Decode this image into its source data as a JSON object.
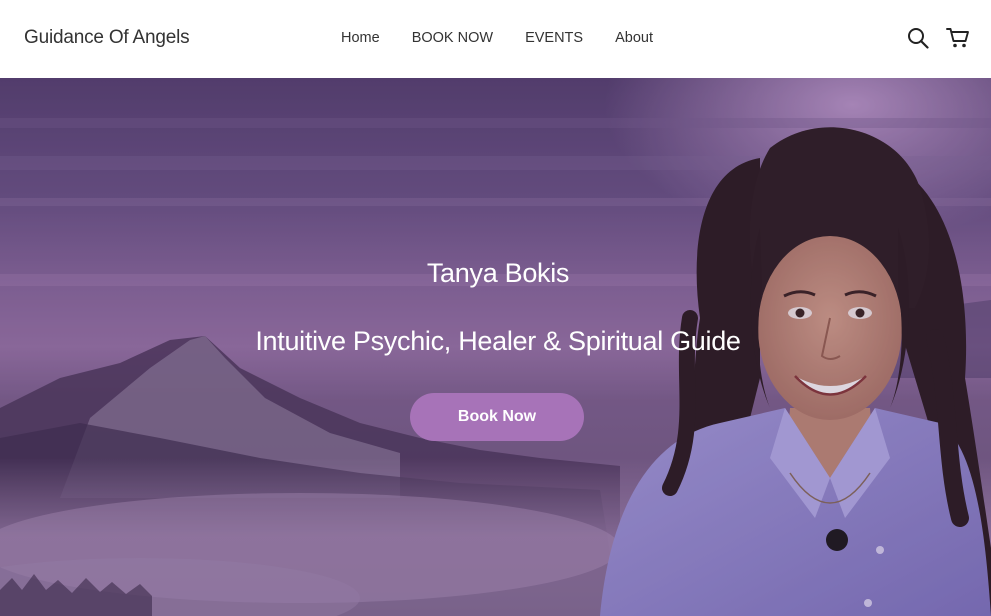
{
  "header": {
    "brand": "Guidance Of Angels",
    "nav": [
      {
        "label": "Home"
      },
      {
        "label": "BOOK NOW"
      },
      {
        "label": "EVENTS"
      },
      {
        "label": "About"
      }
    ],
    "icons": {
      "search": "search-icon",
      "cart": "cart-icon"
    }
  },
  "hero": {
    "name": "Tanya Bokis",
    "subtitle": "Intuitive Psychic, Healer & Spiritual Guide",
    "cta_label": "Book Now"
  },
  "colors": {
    "accent": "#a773b8",
    "hero_purple": "#6a5285",
    "text_dark": "#333333"
  }
}
